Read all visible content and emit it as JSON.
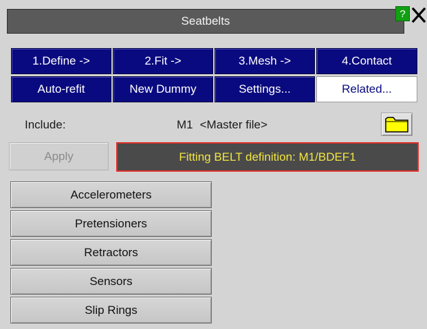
{
  "window": {
    "title": "Seatbelts",
    "help_label": "?"
  },
  "steps": [
    {
      "label": "1.Define ->"
    },
    {
      "label": "2.Fit ->"
    },
    {
      "label": "3.Mesh ->"
    },
    {
      "label": "4.Contact"
    },
    {
      "label": "Auto-refit"
    },
    {
      "label": "New Dummy"
    },
    {
      "label": "Settings..."
    },
    {
      "label": "Related..."
    }
  ],
  "include": {
    "label": "Include:",
    "model": "M1",
    "file": "<Master file>"
  },
  "apply_label": "Apply",
  "status": "Fitting BELT definition: M1/BDEF1",
  "options": [
    {
      "label": "Accelerometers"
    },
    {
      "label": "Pretensioners"
    },
    {
      "label": "Retractors"
    },
    {
      "label": "Sensors"
    },
    {
      "label": "Slip Rings"
    }
  ],
  "colors": {
    "title_bg": "#5a5a5a",
    "step_button_bg": "#0a0a80",
    "status_text": "#f2e642",
    "status_border": "#e0302a",
    "help_bg": "#12a012",
    "folder": "#ffff00"
  },
  "icons": {
    "help": "help-icon",
    "close": "close-icon",
    "folder": "folder-icon"
  }
}
